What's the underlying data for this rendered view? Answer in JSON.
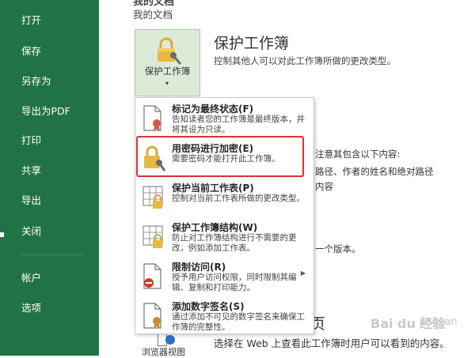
{
  "nav": {
    "items": [
      {
        "label": "打开"
      },
      {
        "label": "保存"
      },
      {
        "label": "另存为"
      },
      {
        "label": "导出为PDF"
      },
      {
        "label": "打印"
      },
      {
        "label": "共享"
      },
      {
        "label": "导出"
      },
      {
        "label": "关闭"
      },
      {
        "label": "帐户"
      },
      {
        "label": "选项"
      }
    ]
  },
  "header": {
    "top_cut": "我的文档",
    "breadcrumb": "我的文档"
  },
  "protect": {
    "button_label": "保护工作簿",
    "caret": "▾",
    "title": "保护工作簿",
    "description": "控制其他人可以对此工作簿所做的更改类型。"
  },
  "menu": {
    "items": [
      {
        "title": "标记为最终状态(F)",
        "desc": "告知读者您的工作簿是最终版本，并将其设为只读。"
      },
      {
        "title": "用密码进行加密(E)",
        "desc": "需要密码才能打开此工作簿。"
      },
      {
        "title": "保护当前工作表(P)",
        "desc": "控制对当前工作表所做的更改类型。"
      },
      {
        "title": "保护工作簿结构(W)",
        "desc": "防止对工作簿结构进行不需要的更改，例如添加工作表。"
      },
      {
        "title": "限制访问(R)",
        "desc": "授予用户访问权限，同时限制其编辑、复制和打印能力。",
        "submenu_arrow": "▶"
      },
      {
        "title": "添加数字签名(S)",
        "desc": "通过添加不可见的数字签名来确保工作簿的完整性。"
      }
    ]
  },
  "background": {
    "line1": "注意其包含以下内容:",
    "line2": "路径、作者的姓名和绝对路径",
    "line3": "内容",
    "line4": "一个版本。",
    "big_letter": "页"
  },
  "browser": {
    "label": "浏览器视图",
    "description": "选择在 Web 上查看此工作簿时用户可以看到的内容。"
  },
  "watermark": {
    "text": "Bai du 经验",
    "sub": "jingyan"
  },
  "colors": {
    "nav_green": "#217346",
    "highlight_red": "#d93232",
    "button_green": "#dcebd8"
  }
}
